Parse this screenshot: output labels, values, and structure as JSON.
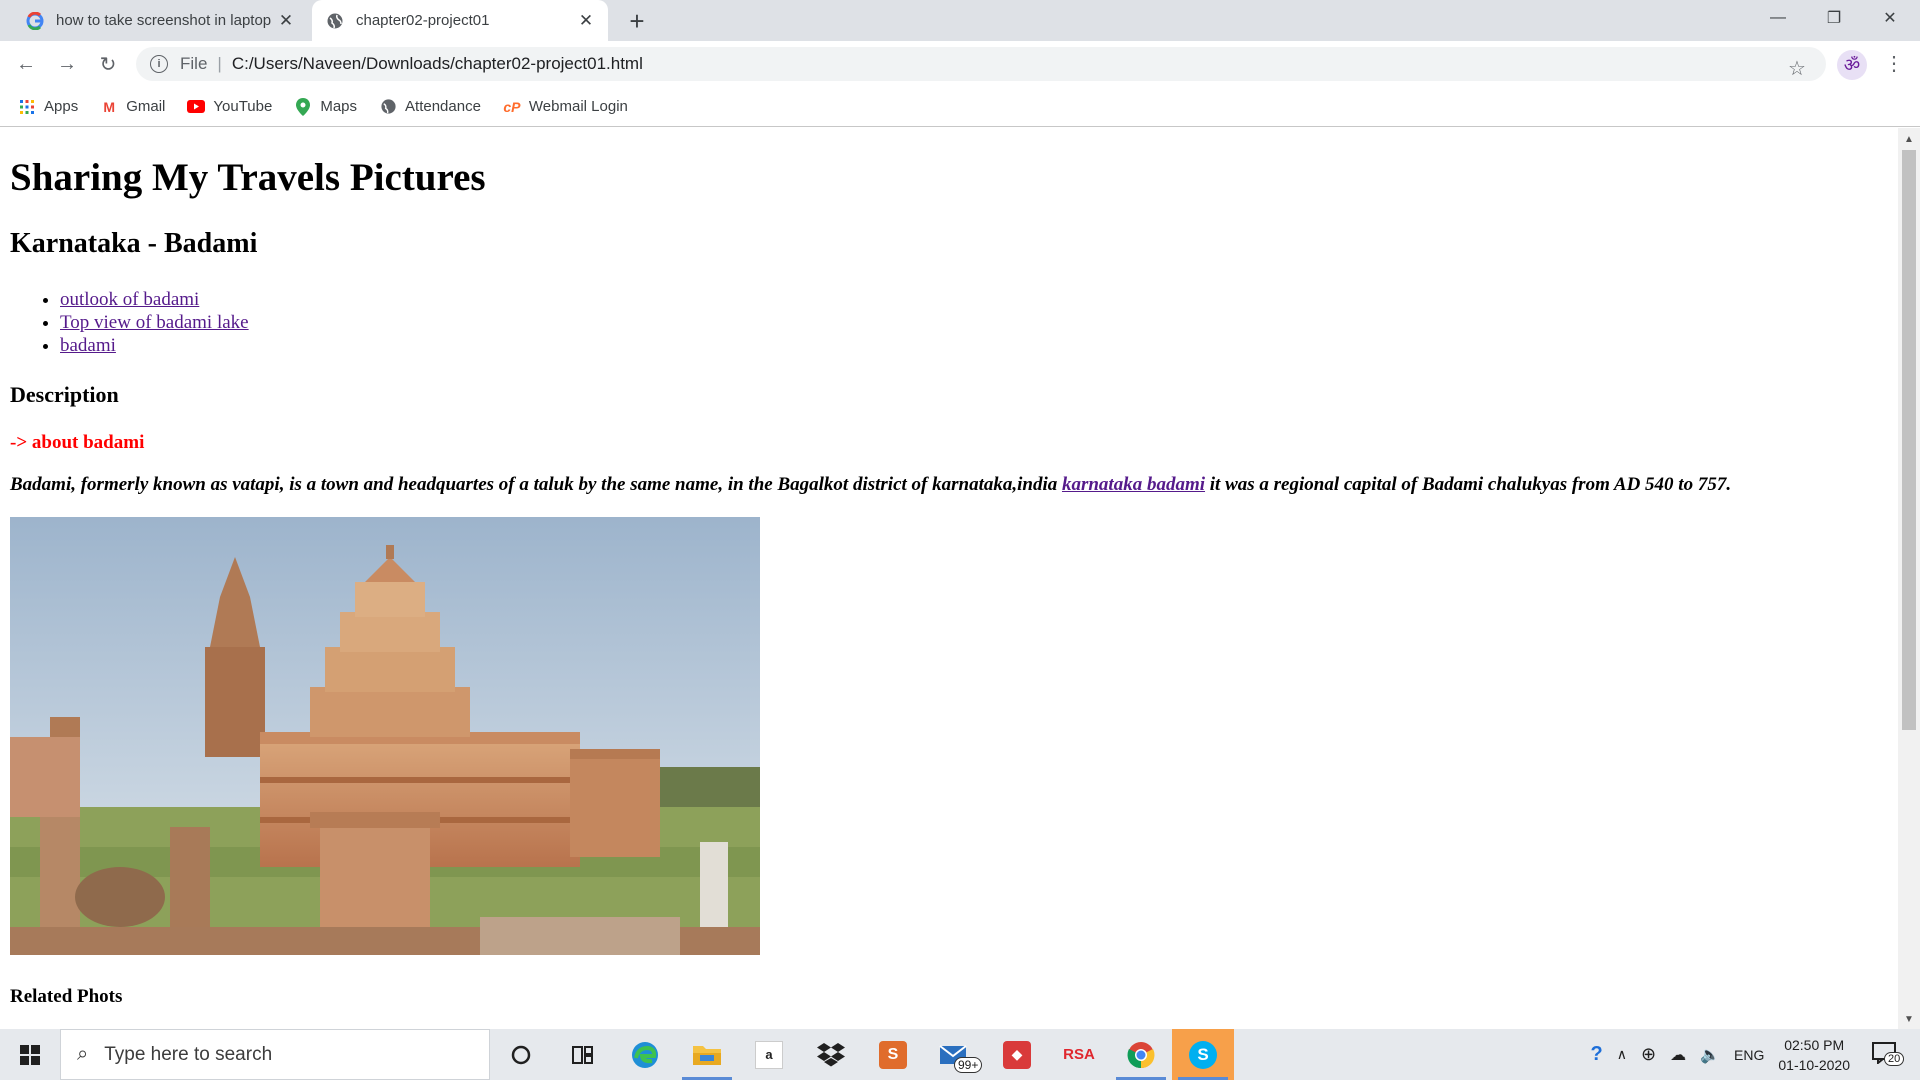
{
  "browser": {
    "tabs": [
      {
        "title": "how to take screenshot in laptop",
        "active": false
      },
      {
        "title": "chapter02-project01",
        "active": true
      }
    ],
    "address": {
      "scheme": "File",
      "url": "C:/Users/Naveen/Downloads/chapter02-project01.html"
    },
    "bookmarks": [
      {
        "label": "Apps",
        "icon": "apps-grid-icon"
      },
      {
        "label": "Gmail",
        "icon": "gmail-icon"
      },
      {
        "label": "YouTube",
        "icon": "youtube-icon"
      },
      {
        "label": "Maps",
        "icon": "maps-pin-icon"
      },
      {
        "label": "Attendance",
        "icon": "globe-icon"
      },
      {
        "label": "Webmail Login",
        "icon": "cpanel-icon"
      }
    ]
  },
  "page": {
    "title": "Sharing My Travels Pictures",
    "subtitle": "Karnataka - Badami",
    "links": [
      "outlook of badami",
      "Top view of badami lake",
      "badami"
    ],
    "description_heading": "Description",
    "about": "-> about badami",
    "desc_before": "Badami, formerly known as vatapi, is a town and headquartes of a taluk by the same name, in the Bagalkot district of karnataka,india ",
    "desc_link": "karnataka badami",
    "desc_after": " it was a regional capital of Badami chalukyas from AD 540 to 757.",
    "related_heading": "Related Phots"
  },
  "taskbar": {
    "search_placeholder": "Type here to search",
    "mail_badge": "99+",
    "rsa_label": "RSA",
    "lang": "ENG",
    "time": "02:50 PM",
    "date": "01-10-2020",
    "notification_count": "20"
  },
  "colors": {
    "visited_link": "#551a8b",
    "about_red": "#ff0000"
  }
}
